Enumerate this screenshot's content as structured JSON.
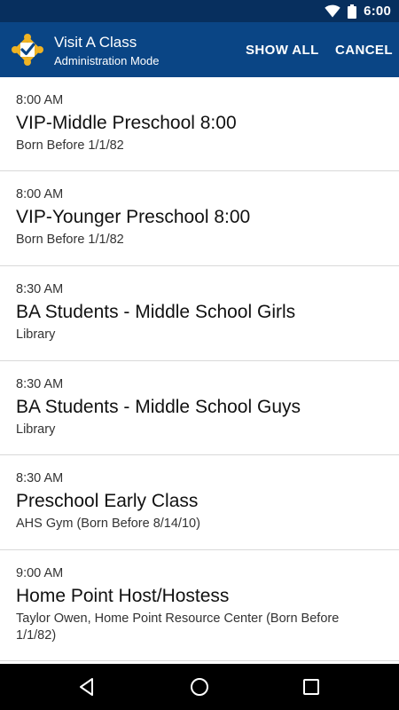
{
  "status_bar": {
    "time": "6:00"
  },
  "app_bar": {
    "title": "Visit A Class",
    "subtitle": "Administration Mode",
    "show_all_label": "SHOW ALL",
    "cancel_label": "CANCEL",
    "logo_icon": "class-check-logo-icon"
  },
  "classes": [
    {
      "time": "8:00 AM",
      "name": "VIP-Middle Preschool 8:00",
      "detail": "Born Before 1/1/82"
    },
    {
      "time": "8:00 AM",
      "name": "VIP-Younger Preschool 8:00",
      "detail": "Born Before 1/1/82"
    },
    {
      "time": "8:30 AM",
      "name": "BA Students - Middle School Girls",
      "detail": "Library"
    },
    {
      "time": "8:30 AM",
      "name": "BA Students - Middle School Guys",
      "detail": "Library"
    },
    {
      "time": "8:30 AM",
      "name": "Preschool Early Class",
      "detail": "AHS Gym (Born Before 8/14/10)"
    },
    {
      "time": "9:00 AM",
      "name": "Home Point Host/Hostess",
      "detail": "Taylor Owen, Home Point Resource Center (Born Before 1/1/82)"
    }
  ],
  "nav_bar": {
    "icons": [
      "back-icon",
      "home-icon",
      "recents-icon"
    ]
  },
  "colors": {
    "status_bar": "#072f5e",
    "app_bar": "#0a4585",
    "logo_gold": "#f0b323",
    "divider": "#d9d9d9"
  }
}
